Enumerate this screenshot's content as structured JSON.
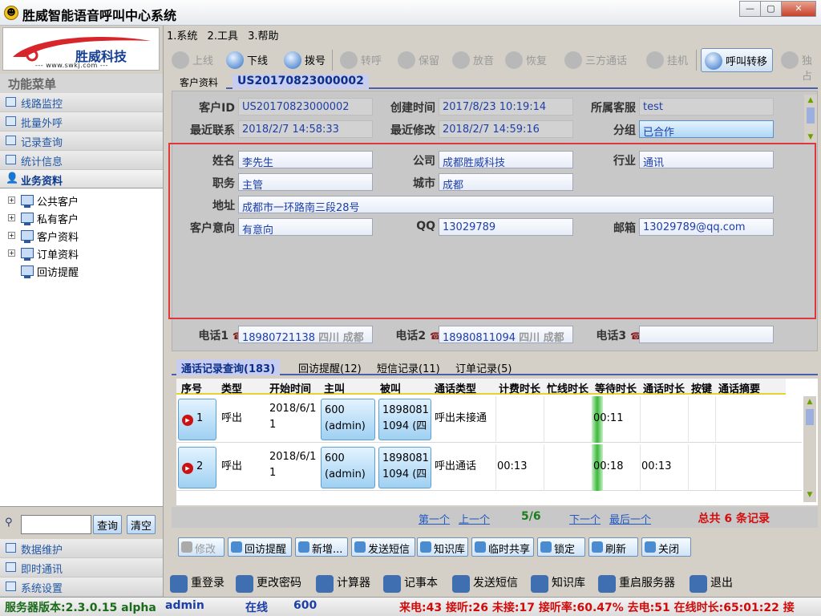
{
  "window": {
    "title": "胜威智能语音呼叫中心系统",
    "min": "—",
    "max": "▢",
    "close": "✕"
  },
  "logo": {
    "brand": "胜威科技",
    "url": "--- www.swkj.com ---"
  },
  "left_menu": {
    "header": "功能菜单",
    "items": [
      "线路监控",
      "批量外呼",
      "记录查询",
      "统计信息",
      "业务资料"
    ],
    "tree": [
      "公共客户",
      "私有客户",
      "客户资料",
      "订单资料",
      "回访提醒"
    ],
    "search_placeholder": "",
    "search_button": "查询",
    "clear_button": "清空",
    "bottom_items": [
      "数据维护",
      "即时通讯",
      "系统设置"
    ]
  },
  "menubar": [
    "1.系统",
    "2.工具",
    "3.帮助"
  ],
  "toolbar": {
    "online": "上线",
    "offline": "下线",
    "dial": "拨号",
    "transfer": "转呼",
    "hold": "保留",
    "playback": "放音",
    "resume": "恢复",
    "conference": "三方通话",
    "hangup": "挂机",
    "call_transfer": "呼叫转移",
    "monitor": "独占"
  },
  "detail_tabs": {
    "label": "客户资料",
    "id": "US20170823000002"
  },
  "customer": {
    "id_label": "客户ID",
    "id": "US20170823000002",
    "created_label": "创建时间",
    "created": "2017/8/23 10:19:14",
    "agent_label": "所属客服",
    "agent": "test",
    "last_contact_label": "最近联系",
    "last_contact": "2018/2/7 14:58:33",
    "last_modified_label": "最近修改",
    "last_modified": "2018/2/7 14:59:16",
    "group_label": "分组",
    "group": "已合作",
    "name_label": "姓名",
    "name": "李先生",
    "company_label": "公司",
    "company": "成都胜威科技",
    "industry_label": "行业",
    "industry": "通讯",
    "position_label": "职务",
    "position": "主管",
    "city_label": "城市",
    "city": "成都",
    "address_label": "地址",
    "address": "成都市一环路南三段28号",
    "intent_label": "客户意向",
    "intent": "有意向",
    "qq_label": "QQ",
    "qq": "13029789",
    "email_label": "邮箱",
    "email": "13029789@qq.com",
    "phone1_label": "电话1",
    "phone1": "18980721138",
    "phone1_loc": "四川 成都",
    "phone2_label": "电话2",
    "phone2": "18980811094",
    "phone2_loc": "四川 成都",
    "phone3_label": "电话3",
    "phone3": ""
  },
  "lower_tabs": [
    "通话记录查询(183)",
    "回访提醒(12)",
    "短信记录(11)",
    "订单记录(5)"
  ],
  "grid": {
    "columns": [
      "序号",
      "类型",
      "开始时间",
      "主叫",
      "被叫",
      "通话类型",
      "计费时长",
      "忙线时长",
      "等待时长",
      "通话时长",
      "按键",
      "通话摘要"
    ],
    "rows": [
      {
        "no": "1",
        "type": "呼出",
        "start": "2018/6/1 1",
        "caller": "600 (admin)",
        "callee": "1898081 1094 (四",
        "call_type": "呼出未接通",
        "billing": "",
        "busy": "",
        "wait": "00:11",
        "duration": "",
        "keys": "",
        "summary": ""
      },
      {
        "no": "2",
        "type": "呼出",
        "start": "2018/6/1 1",
        "caller": "600 (admin)",
        "callee": "1898081 1094 (四",
        "call_type": "呼出通话",
        "billing": "00:13",
        "busy": "",
        "wait": "00:18",
        "duration": "00:13",
        "keys": "",
        "summary": ""
      }
    ]
  },
  "pager": {
    "first": "第一个",
    "prev": "上一个",
    "page": "5/6",
    "next": "下一个",
    "last": "最后一个",
    "total": "总共 6 条记录"
  },
  "actions": [
    "修改",
    "回访提醒",
    "新增...",
    "发送短信",
    "知识库",
    "临时共享",
    "锁定",
    "刷新",
    "关闭"
  ],
  "shortcuts": [
    "重登录",
    "更改密码",
    "计算器",
    "记事本",
    "发送短信",
    "知识库",
    "重启服务器",
    "退出"
  ],
  "status": {
    "version": "服务器版本:2.3.0.15 alpha",
    "user": "admin",
    "online": "在线",
    "ext": "600",
    "stats": "来电:43 接听:26 未接:17 接听率:60.47% 去电:51 在线时长:65:01:22 接"
  },
  "colors": {
    "accent": "#4a5fae",
    "highlight_box": "#e0373f",
    "value_text": "#1d3eab",
    "total_text": "#d20e0e",
    "page_text": "#1b7d1b"
  }
}
